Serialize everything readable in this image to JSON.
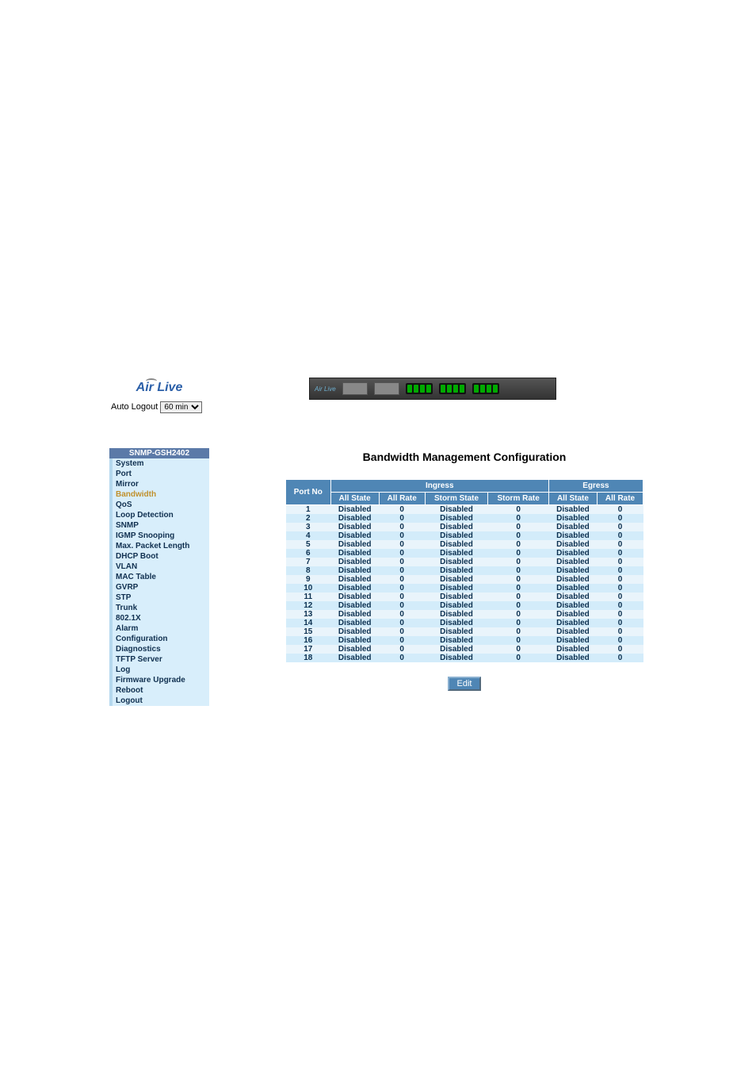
{
  "logo": {
    "text": "Air Live"
  },
  "auto_logout": {
    "label": "Auto Logout",
    "selected": "60 min"
  },
  "device_bar": {
    "label": "Air Live"
  },
  "nav": {
    "title": "SNMP-GSH2402",
    "items": [
      {
        "label": "System",
        "active": false
      },
      {
        "label": "Port",
        "active": false
      },
      {
        "label": "Mirror",
        "active": false
      },
      {
        "label": "Bandwidth",
        "active": true
      },
      {
        "label": "QoS",
        "active": false
      },
      {
        "label": "Loop Detection",
        "active": false
      },
      {
        "label": "SNMP",
        "active": false
      },
      {
        "label": "IGMP Snooping",
        "active": false
      },
      {
        "label": "Max. Packet Length",
        "active": false
      },
      {
        "label": "DHCP Boot",
        "active": false
      },
      {
        "label": "VLAN",
        "active": false
      },
      {
        "label": "MAC Table",
        "active": false
      },
      {
        "label": "GVRP",
        "active": false
      },
      {
        "label": "STP",
        "active": false
      },
      {
        "label": "Trunk",
        "active": false
      },
      {
        "label": "802.1X",
        "active": false
      },
      {
        "label": "Alarm",
        "active": false
      },
      {
        "label": "Configuration",
        "active": false
      },
      {
        "label": "Diagnostics",
        "active": false
      },
      {
        "label": "TFTP Server",
        "active": false
      },
      {
        "label": "Log",
        "active": false
      },
      {
        "label": "Firmware Upgrade",
        "active": false
      },
      {
        "label": "Reboot",
        "active": false
      },
      {
        "label": "Logout",
        "active": false
      }
    ]
  },
  "page": {
    "title": "Bandwidth Management Configuration",
    "headers": {
      "port_no": "Port No",
      "ingress": "Ingress",
      "egress": "Egress",
      "all_state": "All State",
      "all_rate": "All Rate",
      "storm_state": "Storm State",
      "storm_rate": "Storm Rate"
    },
    "rows": [
      {
        "port": "1",
        "in_all_state": "Disabled",
        "in_all_rate": "0",
        "in_storm_state": "Disabled",
        "in_storm_rate": "0",
        "eg_all_state": "Disabled",
        "eg_all_rate": "0"
      },
      {
        "port": "2",
        "in_all_state": "Disabled",
        "in_all_rate": "0",
        "in_storm_state": "Disabled",
        "in_storm_rate": "0",
        "eg_all_state": "Disabled",
        "eg_all_rate": "0"
      },
      {
        "port": "3",
        "in_all_state": "Disabled",
        "in_all_rate": "0",
        "in_storm_state": "Disabled",
        "in_storm_rate": "0",
        "eg_all_state": "Disabled",
        "eg_all_rate": "0"
      },
      {
        "port": "4",
        "in_all_state": "Disabled",
        "in_all_rate": "0",
        "in_storm_state": "Disabled",
        "in_storm_rate": "0",
        "eg_all_state": "Disabled",
        "eg_all_rate": "0"
      },
      {
        "port": "5",
        "in_all_state": "Disabled",
        "in_all_rate": "0",
        "in_storm_state": "Disabled",
        "in_storm_rate": "0",
        "eg_all_state": "Disabled",
        "eg_all_rate": "0"
      },
      {
        "port": "6",
        "in_all_state": "Disabled",
        "in_all_rate": "0",
        "in_storm_state": "Disabled",
        "in_storm_rate": "0",
        "eg_all_state": "Disabled",
        "eg_all_rate": "0"
      },
      {
        "port": "7",
        "in_all_state": "Disabled",
        "in_all_rate": "0",
        "in_storm_state": "Disabled",
        "in_storm_rate": "0",
        "eg_all_state": "Disabled",
        "eg_all_rate": "0"
      },
      {
        "port": "8",
        "in_all_state": "Disabled",
        "in_all_rate": "0",
        "in_storm_state": "Disabled",
        "in_storm_rate": "0",
        "eg_all_state": "Disabled",
        "eg_all_rate": "0"
      },
      {
        "port": "9",
        "in_all_state": "Disabled",
        "in_all_rate": "0",
        "in_storm_state": "Disabled",
        "in_storm_rate": "0",
        "eg_all_state": "Disabled",
        "eg_all_rate": "0"
      },
      {
        "port": "10",
        "in_all_state": "Disabled",
        "in_all_rate": "0",
        "in_storm_state": "Disabled",
        "in_storm_rate": "0",
        "eg_all_state": "Disabled",
        "eg_all_rate": "0"
      },
      {
        "port": "11",
        "in_all_state": "Disabled",
        "in_all_rate": "0",
        "in_storm_state": "Disabled",
        "in_storm_rate": "0",
        "eg_all_state": "Disabled",
        "eg_all_rate": "0"
      },
      {
        "port": "12",
        "in_all_state": "Disabled",
        "in_all_rate": "0",
        "in_storm_state": "Disabled",
        "in_storm_rate": "0",
        "eg_all_state": "Disabled",
        "eg_all_rate": "0"
      },
      {
        "port": "13",
        "in_all_state": "Disabled",
        "in_all_rate": "0",
        "in_storm_state": "Disabled",
        "in_storm_rate": "0",
        "eg_all_state": "Disabled",
        "eg_all_rate": "0"
      },
      {
        "port": "14",
        "in_all_state": "Disabled",
        "in_all_rate": "0",
        "in_storm_state": "Disabled",
        "in_storm_rate": "0",
        "eg_all_state": "Disabled",
        "eg_all_rate": "0"
      },
      {
        "port": "15",
        "in_all_state": "Disabled",
        "in_all_rate": "0",
        "in_storm_state": "Disabled",
        "in_storm_rate": "0",
        "eg_all_state": "Disabled",
        "eg_all_rate": "0"
      },
      {
        "port": "16",
        "in_all_state": "Disabled",
        "in_all_rate": "0",
        "in_storm_state": "Disabled",
        "in_storm_rate": "0",
        "eg_all_state": "Disabled",
        "eg_all_rate": "0"
      },
      {
        "port": "17",
        "in_all_state": "Disabled",
        "in_all_rate": "0",
        "in_storm_state": "Disabled",
        "in_storm_rate": "0",
        "eg_all_state": "Disabled",
        "eg_all_rate": "0"
      },
      {
        "port": "18",
        "in_all_state": "Disabled",
        "in_all_rate": "0",
        "in_storm_state": "Disabled",
        "in_storm_rate": "0",
        "eg_all_state": "Disabled",
        "eg_all_rate": "0"
      }
    ],
    "edit_label": "Edit"
  }
}
